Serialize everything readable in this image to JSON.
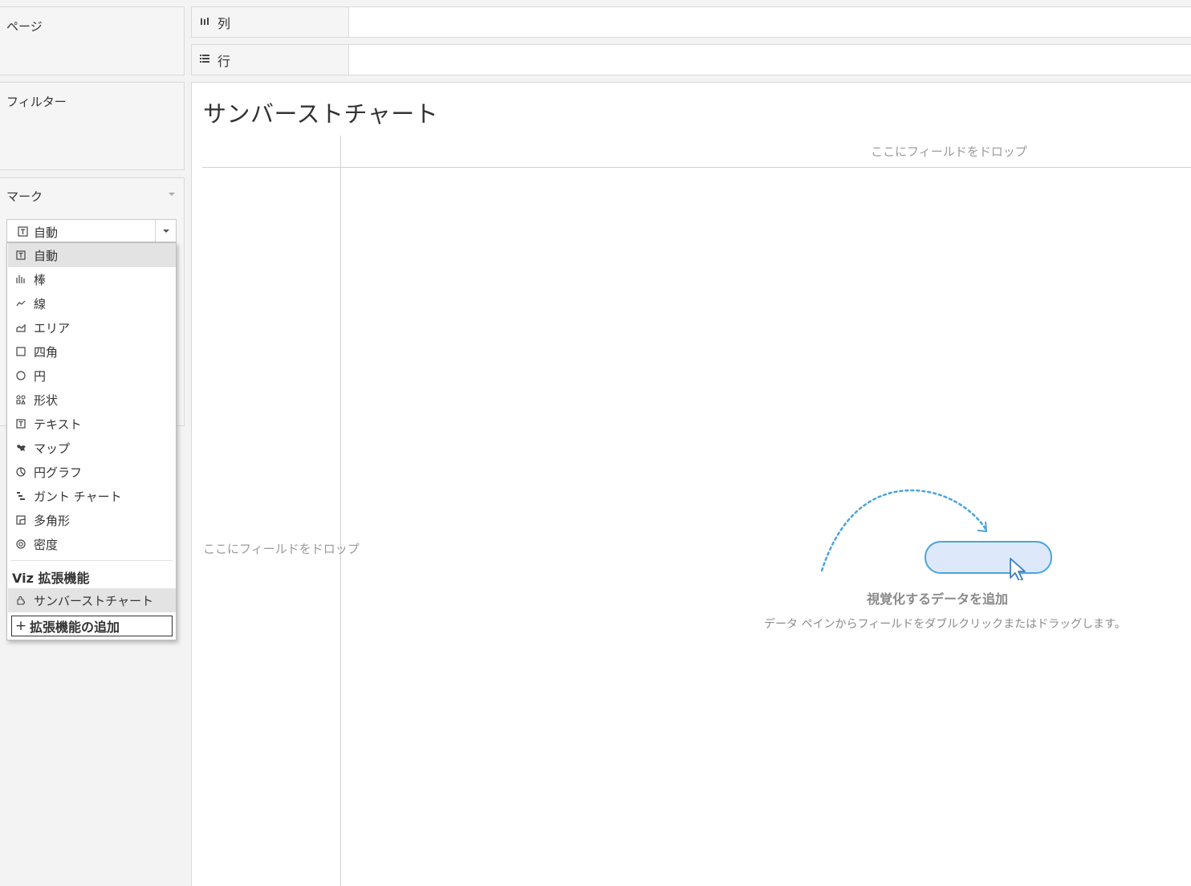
{
  "sidebar": {
    "pages_title": "ページ",
    "filters_title": "フィルター",
    "marks_title": "マーク"
  },
  "shelves": {
    "columns_label": "列",
    "rows_label": "行"
  },
  "sheet": {
    "title": "サンバーストチャート",
    "drop_top": "ここにフィールドをドロップ",
    "drop_left": "ここにフィールドをドロップ"
  },
  "empty_state": {
    "title": "視覚化するデータを追加",
    "subtitle": "データ ペインからフィールドをダブルクリックまたはドラッグします。"
  },
  "mark_type": {
    "selected": "自動",
    "options": [
      {
        "label": "自動",
        "icon": "text-box-icon"
      },
      {
        "label": "棒",
        "icon": "bar-icon"
      },
      {
        "label": "線",
        "icon": "line-icon"
      },
      {
        "label": "エリア",
        "icon": "area-icon"
      },
      {
        "label": "四角",
        "icon": "square-icon"
      },
      {
        "label": "円",
        "icon": "circle-icon"
      },
      {
        "label": "形状",
        "icon": "shapes-icon"
      },
      {
        "label": "テキスト",
        "icon": "text-box-icon"
      },
      {
        "label": "マップ",
        "icon": "map-icon"
      },
      {
        "label": "円グラフ",
        "icon": "pie-icon"
      },
      {
        "label": "ガント チャート",
        "icon": "gantt-icon"
      },
      {
        "label": "多角形",
        "icon": "polygon-icon"
      },
      {
        "label": "密度",
        "icon": "density-icon"
      }
    ],
    "extensions_header": "Viz 拡張機能",
    "extensions": [
      {
        "label": "サンバーストチャート",
        "icon": "extension-icon"
      }
    ],
    "add_extension_label": "拡張機能の追加"
  },
  "colors": {
    "accent_blue": "#4aa3df",
    "pill_fill": "#dde9fa"
  }
}
